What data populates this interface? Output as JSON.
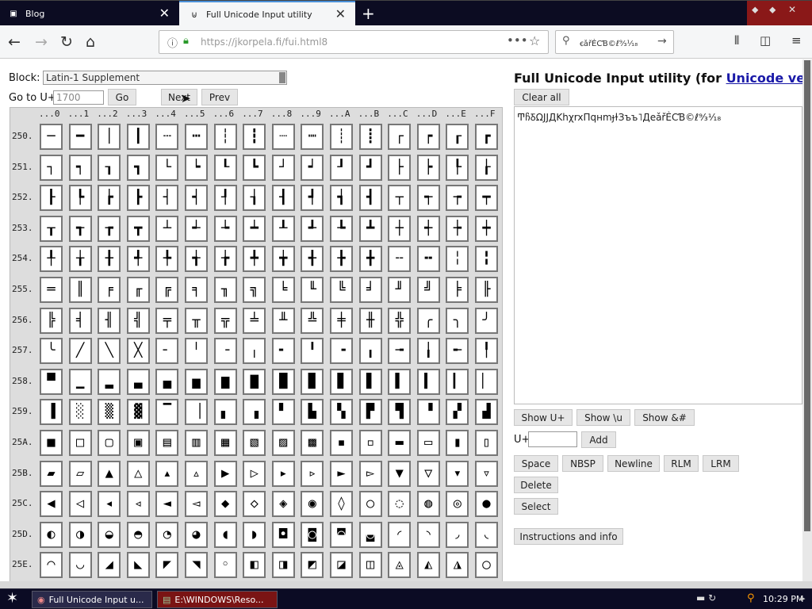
{
  "browser": {
    "tabs": [
      {
        "label": "Blog",
        "icon": "blog-icon"
      },
      {
        "label": "Full Unicode Input utility",
        "icon": "page-icon"
      }
    ],
    "url_info": "ⓘ",
    "url": "https://jkorpela.fi/fui.html8",
    "url_menu": "•••",
    "bookmark": "☆",
    "search_text": "ꞓǎřЀCƁ©ℓ⁹⁄₃¹⁄₁₈",
    "back": "←",
    "forward": "→",
    "reload": "↻",
    "home": "⌂",
    "library": "⫴",
    "sidebar": "◫",
    "menu": "≡",
    "new_tab": "+",
    "close": "✕"
  },
  "page": {
    "block_label": "Block:",
    "block_value": "Latin-1 Supplement",
    "goto_label": "Go to U+",
    "goto_value": "1700",
    "go_button": "Go",
    "next_button": "Next",
    "prev_button": "Prev",
    "title_prefix": "Full Unicode Input utility (for ",
    "title_link": "Unicode version",
    "clear_all": "Clear all",
    "output_text": "ͲჩꝽΩJJДKhχrxΠqʜmɟɫЗъъ˥ДeǎřЀCƁ©ℓ⁹⁄₃¹⁄₁₈",
    "show_u": "Show U+",
    "show_esc": "Show \\u",
    "show_html": "Show &#",
    "uplus_label": "U+",
    "uplus_value": "",
    "add_button": "Add",
    "space": "Space",
    "nbsp": "NBSP",
    "newline": "Newline",
    "rlm": "RLM",
    "lrm": "LRM",
    "delete": "Delete",
    "select": "Select",
    "instructions": "Instructions and info"
  },
  "grid": {
    "col_headers": [
      "...0",
      "...1",
      "...2",
      "...3",
      "...4",
      "...5",
      "...6",
      "...7",
      "...8",
      "...9",
      "...A",
      "...B",
      "...C",
      "...D",
      "...E",
      "...F"
    ],
    "rows": [
      {
        "label": "250.",
        "chars": "─━│┃┄┅┆┇┈┉┊┋┌┍┎┏"
      },
      {
        "label": "251.",
        "chars": "┐┑┒┓└┕┖┗┘┙┚┛├┝┞┟"
      },
      {
        "label": "252.",
        "chars": "┠┡┢┣┤┥┦┧┨┩┪┫┬┭┮┯"
      },
      {
        "label": "253.",
        "chars": "┰┱┲┳┴┵┶┷┸┹┺┻┼┽┾┿"
      },
      {
        "label": "254.",
        "chars": "╀╁╂╃╄╅╆╇╈╉╊╋╌╍╎╏"
      },
      {
        "label": "255.",
        "chars": "═║╒╓╔╕╖╗╘╙╚╛╜╝╞╟"
      },
      {
        "label": "256.",
        "chars": "╠╡╢╣╤╥╦╧╨╩╪╫╬╭╮╯"
      },
      {
        "label": "257.",
        "chars": "╰╱╲╳╴╵╶╷╸╹╺╻╼╽╾╿"
      },
      {
        "label": "258.",
        "chars": "▀▁▂▃▄▅▆▇█▉▊▋▌▍▎▏"
      },
      {
        "label": "259.",
        "chars": "▐░▒▓▔▕▖▗▘▙▚▛▜▝▞▟"
      },
      {
        "label": "25A.",
        "chars": "■□▢▣▤▥▦▧▨▩▪▫▬▭▮▯"
      },
      {
        "label": "25B.",
        "chars": "▰▱▲△▴▵▶▷▸▹►▻▼▽▾▿"
      },
      {
        "label": "25C.",
        "chars": "◀◁◂◃◄◅◆◇◈◉◊○◌◍◎●"
      },
      {
        "label": "25D.",
        "chars": "◐◑◒◓◔◕◖◗◘◙◚◛◜◝◞◟"
      },
      {
        "label": "25E.",
        "chars": "◠◡◢◣◤◥◦◧◨◩◪◫◬◭◮◯"
      }
    ]
  },
  "taskbar": {
    "start": "✶",
    "items": [
      {
        "label": "Full Unicode Input u...",
        "icon": "firefox-icon"
      },
      {
        "label": "E:\\WINDOWS\\Reso...",
        "icon": "notepad-icon"
      }
    ],
    "tray": "▬  ↻",
    "clock": "10:29 PM"
  },
  "colors": {
    "accent": "#4a90d9",
    "tabbar": "#0c0c22",
    "link": "#1a1aa8",
    "close_area": "#8a1818"
  }
}
